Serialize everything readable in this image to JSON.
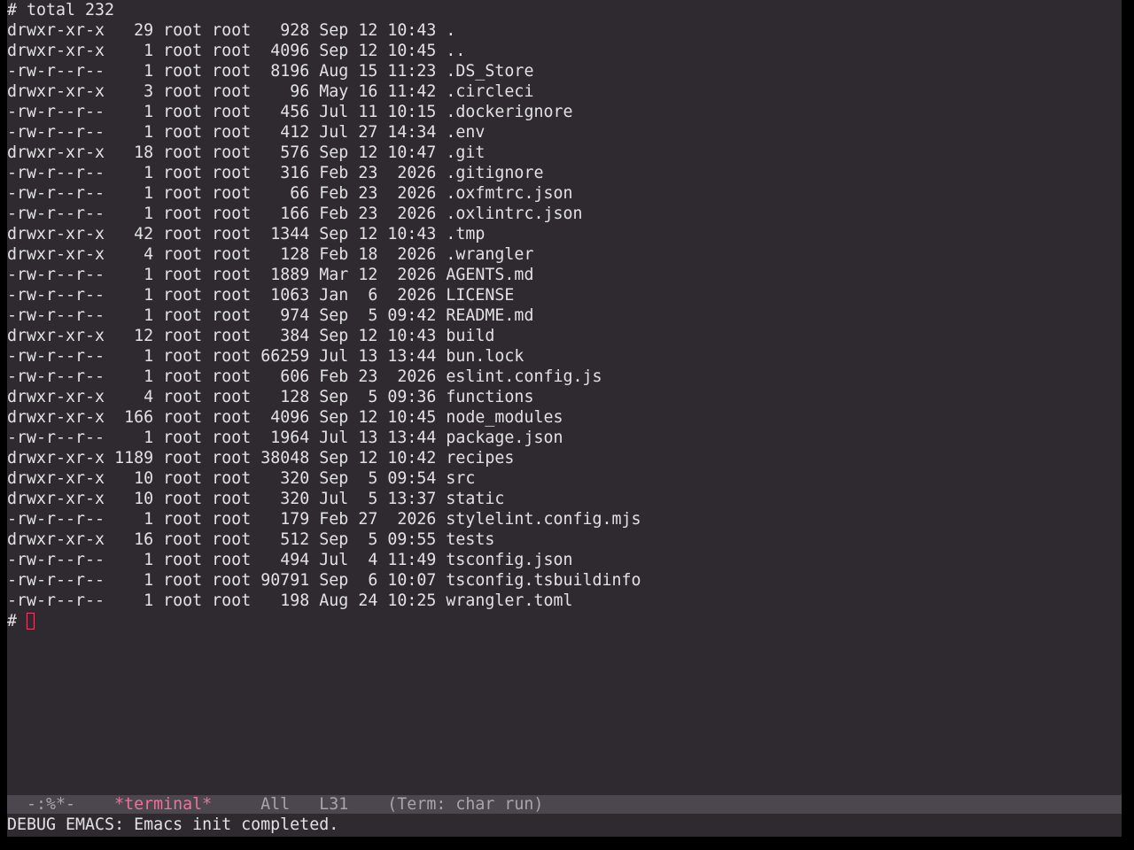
{
  "terminal": {
    "header": "# total 232",
    "entries": [
      {
        "perm": "drwxr-xr-x",
        "links": "29",
        "owner": "root",
        "group": "root",
        "size": "928",
        "month": "Sep",
        "day": "12",
        "time": "10:43",
        "name": "."
      },
      {
        "perm": "drwxr-xr-x",
        "links": "1",
        "owner": "root",
        "group": "root",
        "size": "4096",
        "month": "Sep",
        "day": "12",
        "time": "10:45",
        "name": ".."
      },
      {
        "perm": "-rw-r--r--",
        "links": "1",
        "owner": "root",
        "group": "root",
        "size": "8196",
        "month": "Aug",
        "day": "15",
        "time": "11:23",
        "name": ".DS_Store"
      },
      {
        "perm": "drwxr-xr-x",
        "links": "3",
        "owner": "root",
        "group": "root",
        "size": "96",
        "month": "May",
        "day": "16",
        "time": "11:42",
        "name": ".circleci"
      },
      {
        "perm": "-rw-r--r--",
        "links": "1",
        "owner": "root",
        "group": "root",
        "size": "456",
        "month": "Jul",
        "day": "11",
        "time": "10:15",
        "name": ".dockerignore"
      },
      {
        "perm": "-rw-r--r--",
        "links": "1",
        "owner": "root",
        "group": "root",
        "size": "412",
        "month": "Jul",
        "day": "27",
        "time": "14:34",
        "name": ".env"
      },
      {
        "perm": "drwxr-xr-x",
        "links": "18",
        "owner": "root",
        "group": "root",
        "size": "576",
        "month": "Sep",
        "day": "12",
        "time": "10:47",
        "name": ".git"
      },
      {
        "perm": "-rw-r--r--",
        "links": "1",
        "owner": "root",
        "group": "root",
        "size": "316",
        "month": "Feb",
        "day": "23",
        "time": "2026",
        "name": ".gitignore"
      },
      {
        "perm": "-rw-r--r--",
        "links": "1",
        "owner": "root",
        "group": "root",
        "size": "66",
        "month": "Feb",
        "day": "23",
        "time": "2026",
        "name": ".oxfmtrc.json"
      },
      {
        "perm": "-rw-r--r--",
        "links": "1",
        "owner": "root",
        "group": "root",
        "size": "166",
        "month": "Feb",
        "day": "23",
        "time": "2026",
        "name": ".oxlintrc.json"
      },
      {
        "perm": "drwxr-xr-x",
        "links": "42",
        "owner": "root",
        "group": "root",
        "size": "1344",
        "month": "Sep",
        "day": "12",
        "time": "10:43",
        "name": ".tmp"
      },
      {
        "perm": "drwxr-xr-x",
        "links": "4",
        "owner": "root",
        "group": "root",
        "size": "128",
        "month": "Feb",
        "day": "18",
        "time": "2026",
        "name": ".wrangler"
      },
      {
        "perm": "-rw-r--r--",
        "links": "1",
        "owner": "root",
        "group": "root",
        "size": "1889",
        "month": "Mar",
        "day": "12",
        "time": "2026",
        "name": "AGENTS.md"
      },
      {
        "perm": "-rw-r--r--",
        "links": "1",
        "owner": "root",
        "group": "root",
        "size": "1063",
        "month": "Jan",
        "day": "6",
        "time": "2026",
        "name": "LICENSE"
      },
      {
        "perm": "-rw-r--r--",
        "links": "1",
        "owner": "root",
        "group": "root",
        "size": "974",
        "month": "Sep",
        "day": "5",
        "time": "09:42",
        "name": "README.md"
      },
      {
        "perm": "drwxr-xr-x",
        "links": "12",
        "owner": "root",
        "group": "root",
        "size": "384",
        "month": "Sep",
        "day": "12",
        "time": "10:43",
        "name": "build"
      },
      {
        "perm": "-rw-r--r--",
        "links": "1",
        "owner": "root",
        "group": "root",
        "size": "66259",
        "month": "Jul",
        "day": "13",
        "time": "13:44",
        "name": "bun.lock"
      },
      {
        "perm": "-rw-r--r--",
        "links": "1",
        "owner": "root",
        "group": "root",
        "size": "606",
        "month": "Feb",
        "day": "23",
        "time": "2026",
        "name": "eslint.config.js"
      },
      {
        "perm": "drwxr-xr-x",
        "links": "4",
        "owner": "root",
        "group": "root",
        "size": "128",
        "month": "Sep",
        "day": "5",
        "time": "09:36",
        "name": "functions"
      },
      {
        "perm": "drwxr-xr-x",
        "links": "166",
        "owner": "root",
        "group": "root",
        "size": "4096",
        "month": "Sep",
        "day": "12",
        "time": "10:45",
        "name": "node_modules"
      },
      {
        "perm": "-rw-r--r--",
        "links": "1",
        "owner": "root",
        "group": "root",
        "size": "1964",
        "month": "Jul",
        "day": "13",
        "time": "13:44",
        "name": "package.json"
      },
      {
        "perm": "drwxr-xr-x",
        "links": "1189",
        "owner": "root",
        "group": "root",
        "size": "38048",
        "month": "Sep",
        "day": "12",
        "time": "10:42",
        "name": "recipes"
      },
      {
        "perm": "drwxr-xr-x",
        "links": "10",
        "owner": "root",
        "group": "root",
        "size": "320",
        "month": "Sep",
        "day": "5",
        "time": "09:54",
        "name": "src"
      },
      {
        "perm": "drwxr-xr-x",
        "links": "10",
        "owner": "root",
        "group": "root",
        "size": "320",
        "month": "Jul",
        "day": "5",
        "time": "13:37",
        "name": "static"
      },
      {
        "perm": "-rw-r--r--",
        "links": "1",
        "owner": "root",
        "group": "root",
        "size": "179",
        "month": "Feb",
        "day": "27",
        "time": "2026",
        "name": "stylelint.config.mjs"
      },
      {
        "perm": "drwxr-xr-x",
        "links": "16",
        "owner": "root",
        "group": "root",
        "size": "512",
        "month": "Sep",
        "day": "5",
        "time": "09:55",
        "name": "tests"
      },
      {
        "perm": "-rw-r--r--",
        "links": "1",
        "owner": "root",
        "group": "root",
        "size": "494",
        "month": "Jul",
        "day": "4",
        "time": "11:49",
        "name": "tsconfig.json"
      },
      {
        "perm": "-rw-r--r--",
        "links": "1",
        "owner": "root",
        "group": "root",
        "size": "90791",
        "month": "Sep",
        "day": "6",
        "time": "10:07",
        "name": "tsconfig.tsbuildinfo"
      },
      {
        "perm": "-rw-r--r--",
        "links": "1",
        "owner": "root",
        "group": "root",
        "size": "198",
        "month": "Aug",
        "day": "24",
        "time": "10:25",
        "name": "wrangler.toml"
      }
    ],
    "prompt": "# "
  },
  "modeline": {
    "status": "-:%*-",
    "buffer_name": "*terminal*",
    "position": "All",
    "line": "L31",
    "mode": "(Term: char run)"
  },
  "echo_area": {
    "message": "DEBUG EMACS: Emacs init completed."
  },
  "colors": {
    "background": "#2e2a30",
    "modeline_background": "#4c474f",
    "buffer_name": "#e8759a",
    "cursor": "#e34668"
  }
}
